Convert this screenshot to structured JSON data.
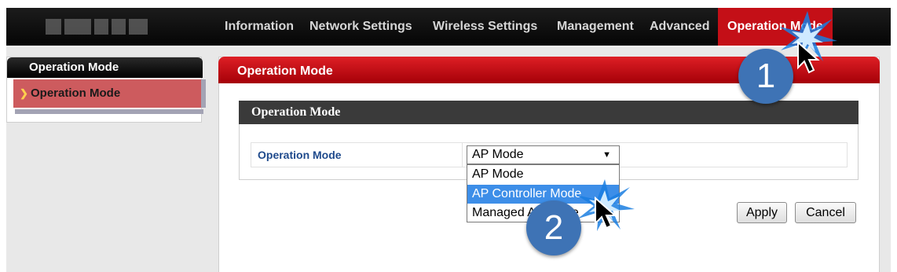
{
  "brand": {
    "logo_blurred": true
  },
  "nav": {
    "items": [
      {
        "label": "Information"
      },
      {
        "label": "Network Settings"
      },
      {
        "label": "Wireless Settings"
      },
      {
        "label": "Management"
      },
      {
        "label": "Advanced"
      },
      {
        "label": "Operation Mode",
        "active": true
      }
    ]
  },
  "sidebar": {
    "title": "Operation Mode",
    "items": [
      {
        "label": "Operation Mode",
        "selected": true
      }
    ]
  },
  "panel": {
    "title": "Operation Mode",
    "section_title": "Operation Mode",
    "field": {
      "label": "Operation Mode",
      "value": "AP Mode",
      "options": [
        {
          "label": "AP Mode"
        },
        {
          "label": "AP Controller Mode",
          "highlighted": true
        },
        {
          "label": "Managed AP Mode"
        }
      ]
    },
    "buttons": {
      "apply": "Apply",
      "cancel": "Cancel"
    }
  },
  "callouts": [
    {
      "number": "1"
    },
    {
      "number": "2"
    }
  ],
  "colors": {
    "nav_active": "#c40f17",
    "panel_header": "#d2151b",
    "sidebar_selected": "#cd5b5e",
    "option_highlight": "#3d8ee8",
    "callout": "#3e73b5"
  }
}
